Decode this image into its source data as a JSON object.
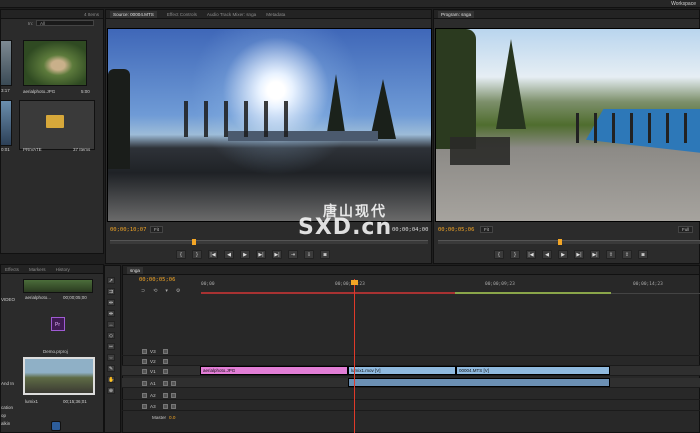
{
  "app": {
    "workspace_label": "Workspace"
  },
  "project": {
    "items_count": "4 Items",
    "in_label": "In:",
    "in_value": "All",
    "items": [
      {
        "name": "",
        "duration": "3:17"
      },
      {
        "name": "aerialphoto.JPG",
        "duration": "5:00"
      },
      {
        "name": "",
        "duration": "0:01"
      },
      {
        "name": "PRIVATE",
        "duration": "37 Items"
      }
    ]
  },
  "media_panel": {
    "tabs": [
      "Effects",
      "Markers",
      "History"
    ],
    "side_labels": [
      "VIDEO",
      "And In",
      "cation",
      "op",
      "alkin"
    ],
    "items": [
      {
        "name": "aerialphoto...",
        "duration": "00;00;05;00"
      },
      {
        "name": "Demo.prproj",
        "duration": ""
      },
      {
        "name": "lumix1",
        "duration": "00;15;36;01"
      }
    ]
  },
  "source_monitor": {
    "tabs": [
      "Source: 00004.MTS",
      "Effect Controls",
      "Audio Track Mixer: snga",
      "Metadata"
    ],
    "timecode_left": "00;00;10;07",
    "fit": "Fit",
    "timecode_right": "00;00;04;00"
  },
  "program_monitor": {
    "tabs": [
      "Program: snga"
    ],
    "timecode_left": "00;00;05;06",
    "fit": "Fit",
    "zoom": "Full"
  },
  "timeline": {
    "tab": "snga",
    "timecode": "00;00;05;06",
    "ruler": [
      "00;00",
      "00;00;04;23",
      "00;00;09;23",
      "00;00;14;23"
    ],
    "tracks": [
      "V3",
      "V2",
      "V1",
      "A1",
      "A2",
      "A3"
    ],
    "master_label": "Master",
    "master_value": "0.0",
    "clips": [
      {
        "name": "aerialphoto.JPG"
      },
      {
        "name": "lumix1.mov [V]"
      },
      {
        "name": "00004.MTS [V]"
      }
    ]
  },
  "watermark": {
    "cn": "唐山现代",
    "latin": "SXD.cn"
  },
  "colors": {
    "timecode": "#f3a626",
    "clip_image": "#e27ed6",
    "clip_video": "#8fb9de",
    "playhead": "#e03a2a"
  }
}
